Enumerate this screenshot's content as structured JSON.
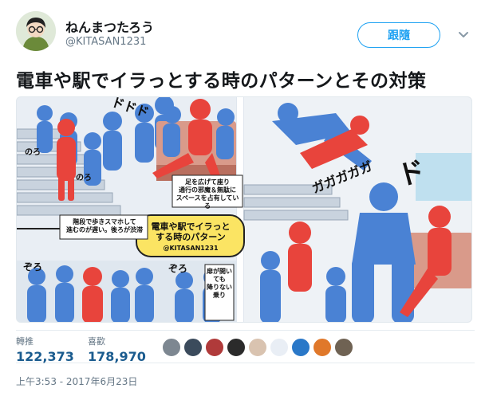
{
  "user": {
    "display_name": "ねんまつたろう",
    "handle": "@KITASAN1231",
    "avatar_icon": "user-avatar"
  },
  "follow_button": {
    "label": "跟隨"
  },
  "menu_icon": "chevron-down-icon",
  "tweet": {
    "text": "電車や駅でイラっとする時のパターンとその対策"
  },
  "media": {
    "alt": "manga illustration",
    "captions": {
      "sfx_left": "ドドド",
      "stairs_note": "階段で歩きスマホして\n進むのが遅い。後ろが渋滞",
      "seat_note": "足を広げて座り\n通行の邪魔＆無駄に\nスペースを占有している",
      "title_badge": "電車や駅でイラっと\nする時のパターン",
      "title_badge_credit": "@KITASAN1231",
      "door_note": "扉が開いても\n降りない乗り",
      "noro1": "のろ",
      "noro2": "のろ",
      "zoro1": "ぞろ",
      "zoro2": "ぞろ",
      "sfx_right": "ガガガガガ",
      "sfx_big": "ド"
    }
  },
  "stats": {
    "retweets_label": "轉推",
    "retweets_value": "122,373",
    "likes_label": "喜歡",
    "likes_value": "178,970"
  },
  "likers_colors": [
    "#7d8791",
    "#3b4b5c",
    "#b03a3a",
    "#2b2b2b",
    "#d9c3b0",
    "#e9eef5",
    "#2a78c8",
    "#e0782a",
    "#6f6253"
  ],
  "timestamp": "上午3:53 - 2017年6月23日",
  "colors": {
    "accent": "#1da1f2",
    "red_figure": "#e8443c",
    "blue_figure": "#4a82d4"
  }
}
